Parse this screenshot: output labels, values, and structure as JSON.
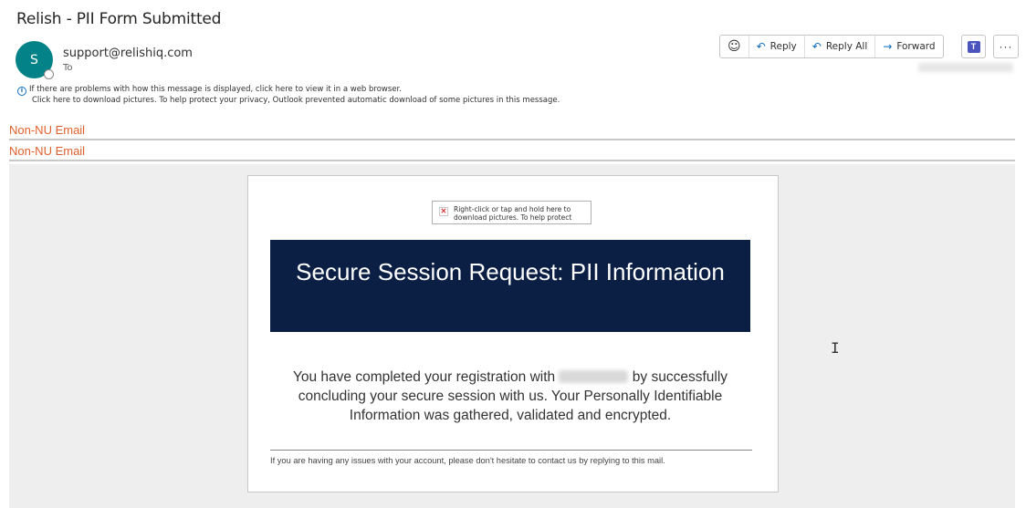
{
  "email": {
    "subject": "Relish - PII Form Submitted",
    "avatar_initial": "S",
    "sender": "support@relishiq.com",
    "to_label": "To",
    "info_notice": "If there are problems with how this message is displayed, click here to view it in a web browser.",
    "download_notice": "Click here to download pictures. To help protect your privacy, Outlook prevented automatic download of some pictures in this message."
  },
  "toolbar": {
    "reply_label": "Reply",
    "reply_all_label": "Reply All",
    "forward_label": "Forward",
    "more_label": "···"
  },
  "tags": {
    "first": "Non-NU Email",
    "second": "Non-NU Email"
  },
  "message": {
    "image_placeholder_text": "Right-click or tap and hold here to download pictures. To help protect",
    "banner_title": "Secure Session Request: PII Information",
    "body_part1": "You have completed your registration with",
    "body_part2": "by successfully concluding your secure session with us. Your Personally Identifiable Information was gathered, validated and encrypted.",
    "footer": "If you are having any issues with your account, please don't hesitate to contact us by replying to this mail."
  },
  "icons": {
    "emoji": "smiley-icon",
    "reply": "reply-arrow-icon",
    "reply_all": "reply-all-arrow-icon",
    "forward": "forward-arrow-icon",
    "teams": "teams-icon",
    "info": "info-icon",
    "broken_image": "broken-image-icon"
  },
  "colors": {
    "avatar": "#038387",
    "banner": "#0b1f45",
    "tag_text": "#e1602e",
    "accent": "#0f6cbd"
  }
}
